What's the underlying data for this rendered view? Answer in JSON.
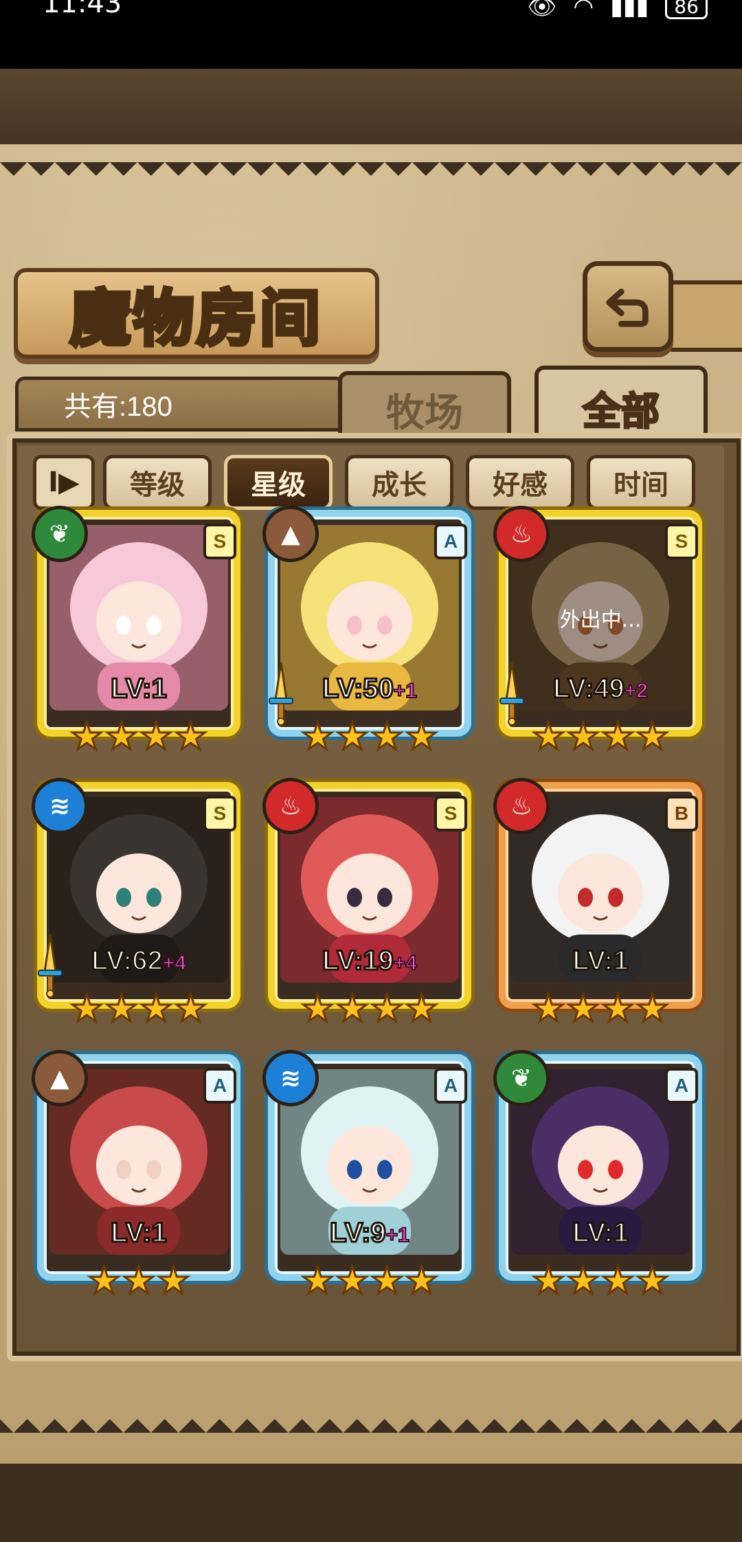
{
  "status_bar": {
    "time": "11:43",
    "battery": "86"
  },
  "header": {
    "title": "魔物房间"
  },
  "count_label": "共有:180",
  "tabs": [
    {
      "label": "牧场"
    },
    {
      "label": "全部"
    }
  ],
  "sort": {
    "toggle_symbol": "I▶",
    "buttons": [
      "等级",
      "星级",
      "成长",
      "好感",
      "时间"
    ],
    "active": "星级"
  },
  "cards": [
    {
      "element": "grass",
      "rank": "S",
      "level": "LV:1",
      "plus": "",
      "stars": 4,
      "weapon": false,
      "status": ""
    },
    {
      "element": "earth",
      "rank": "A",
      "level": "LV:50",
      "plus": "+1",
      "stars": 4,
      "weapon": true,
      "status": ""
    },
    {
      "element": "fire",
      "rank": "S",
      "level": "LV:49",
      "plus": "+2",
      "stars": 4,
      "weapon": true,
      "status": "外出中..."
    },
    {
      "element": "water",
      "rank": "S",
      "level": "LV:62",
      "plus": "+4",
      "stars": 4,
      "weapon": true,
      "status": ""
    },
    {
      "element": "fire",
      "rank": "S",
      "level": "LV:19",
      "plus": "+4",
      "stars": 4,
      "weapon": false,
      "status": ""
    },
    {
      "element": "fire",
      "rank": "B",
      "level": "LV:1",
      "plus": "",
      "stars": 4,
      "weapon": false,
      "status": ""
    },
    {
      "element": "earth",
      "rank": "A",
      "level": "LV:1",
      "plus": "",
      "stars": 3,
      "weapon": false,
      "status": ""
    },
    {
      "element": "water",
      "rank": "A",
      "level": "LV:9",
      "plus": "+1",
      "stars": 4,
      "weapon": false,
      "status": ""
    },
    {
      "element": "grass",
      "rank": "A",
      "level": "LV:1",
      "plus": "",
      "stars": 4,
      "weapon": false,
      "status": ""
    }
  ],
  "colors": {
    "grass": "#2e8a3a",
    "earth": "#8a5a3a",
    "fire": "#d22a2a",
    "water": "#1e7fd6",
    "frame_S": "#f3d22a",
    "frame_A": "#8fd3ef",
    "frame_B": "#f0a04a"
  }
}
